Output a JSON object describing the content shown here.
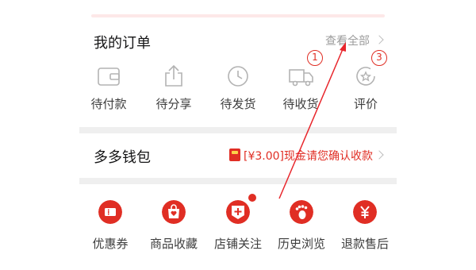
{
  "orders": {
    "title": "我的订单",
    "view_all": "查看全部",
    "items": [
      {
        "label": "待付款",
        "icon": "wallet-icon"
      },
      {
        "label": "待分享",
        "icon": "share-icon"
      },
      {
        "label": "待发货",
        "icon": "clock-icon"
      },
      {
        "label": "待收货",
        "icon": "truck-icon",
        "badge": "1"
      },
      {
        "label": "评价",
        "icon": "review-icon",
        "badge": "3"
      }
    ]
  },
  "wallet": {
    "title": "多多钱包",
    "promo": "[¥3.00]现金请您确认收款"
  },
  "tools": {
    "items": [
      {
        "label": "优惠券",
        "icon": "coupon-icon"
      },
      {
        "label": "商品收藏",
        "icon": "bag-heart-icon"
      },
      {
        "label": "店铺关注",
        "icon": "shop-follow-icon",
        "dot": true
      },
      {
        "label": "历史浏览",
        "icon": "footprint-icon"
      },
      {
        "label": "退款售后",
        "icon": "yuan-icon"
      }
    ]
  },
  "colors": {
    "accent": "#e02e24",
    "text": "#151516",
    "muted": "#9c9c9c",
    "separator": "#efefef",
    "annotation": "#e8262c"
  }
}
